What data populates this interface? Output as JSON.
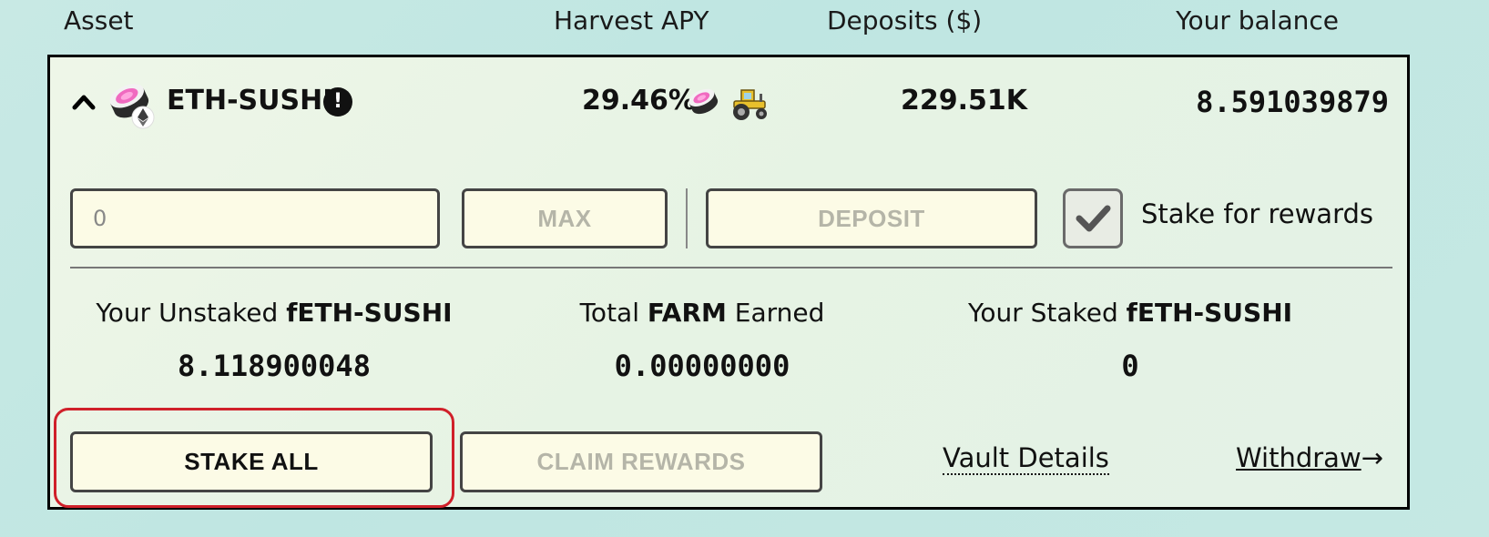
{
  "columns": {
    "asset": "Asset",
    "harvest_apy": "Harvest APY",
    "deposits": "Deposits ($)",
    "your_balance": "Your balance"
  },
  "vault": {
    "name": "ETH-SUSHI",
    "apy": "29.46%",
    "deposits": "229.51K",
    "balance": "8.591039879",
    "icons": {
      "expand": "chevron-up-icon",
      "asset": "sushi-eth-icon",
      "info": "info-icon",
      "apy_reward_1": "sushi-icon",
      "apy_reward_2": "tractor-icon"
    }
  },
  "actions": {
    "amount_placeholder": "0",
    "max_label": "MAX",
    "deposit_label": "DEPOSIT",
    "stake_for_rewards_label": "Stake for rewards",
    "stake_for_rewards_checked": true
  },
  "stats": [
    {
      "prefix": "Your Unstaked ",
      "bold": "fETH-SUSHI",
      "suffix": "",
      "value": "8.118900048"
    },
    {
      "prefix": "Total ",
      "bold": "FARM",
      "suffix": " Earned",
      "value": "0.00000000"
    },
    {
      "prefix": "Your Staked ",
      "bold": "fETH-SUSHI",
      "suffix": "",
      "value": "0"
    }
  ],
  "footer": {
    "stake_all_label": "STAKE ALL",
    "claim_rewards_label": "CLAIM REWARDS",
    "vault_details_label": "Vault Details",
    "withdraw_label": "Withdraw",
    "withdraw_arrow": "→"
  },
  "colors": {
    "highlight_border": "#d0202a",
    "button_bg": "#fcfbe6",
    "disabled_text": "#b5b5a8"
  }
}
